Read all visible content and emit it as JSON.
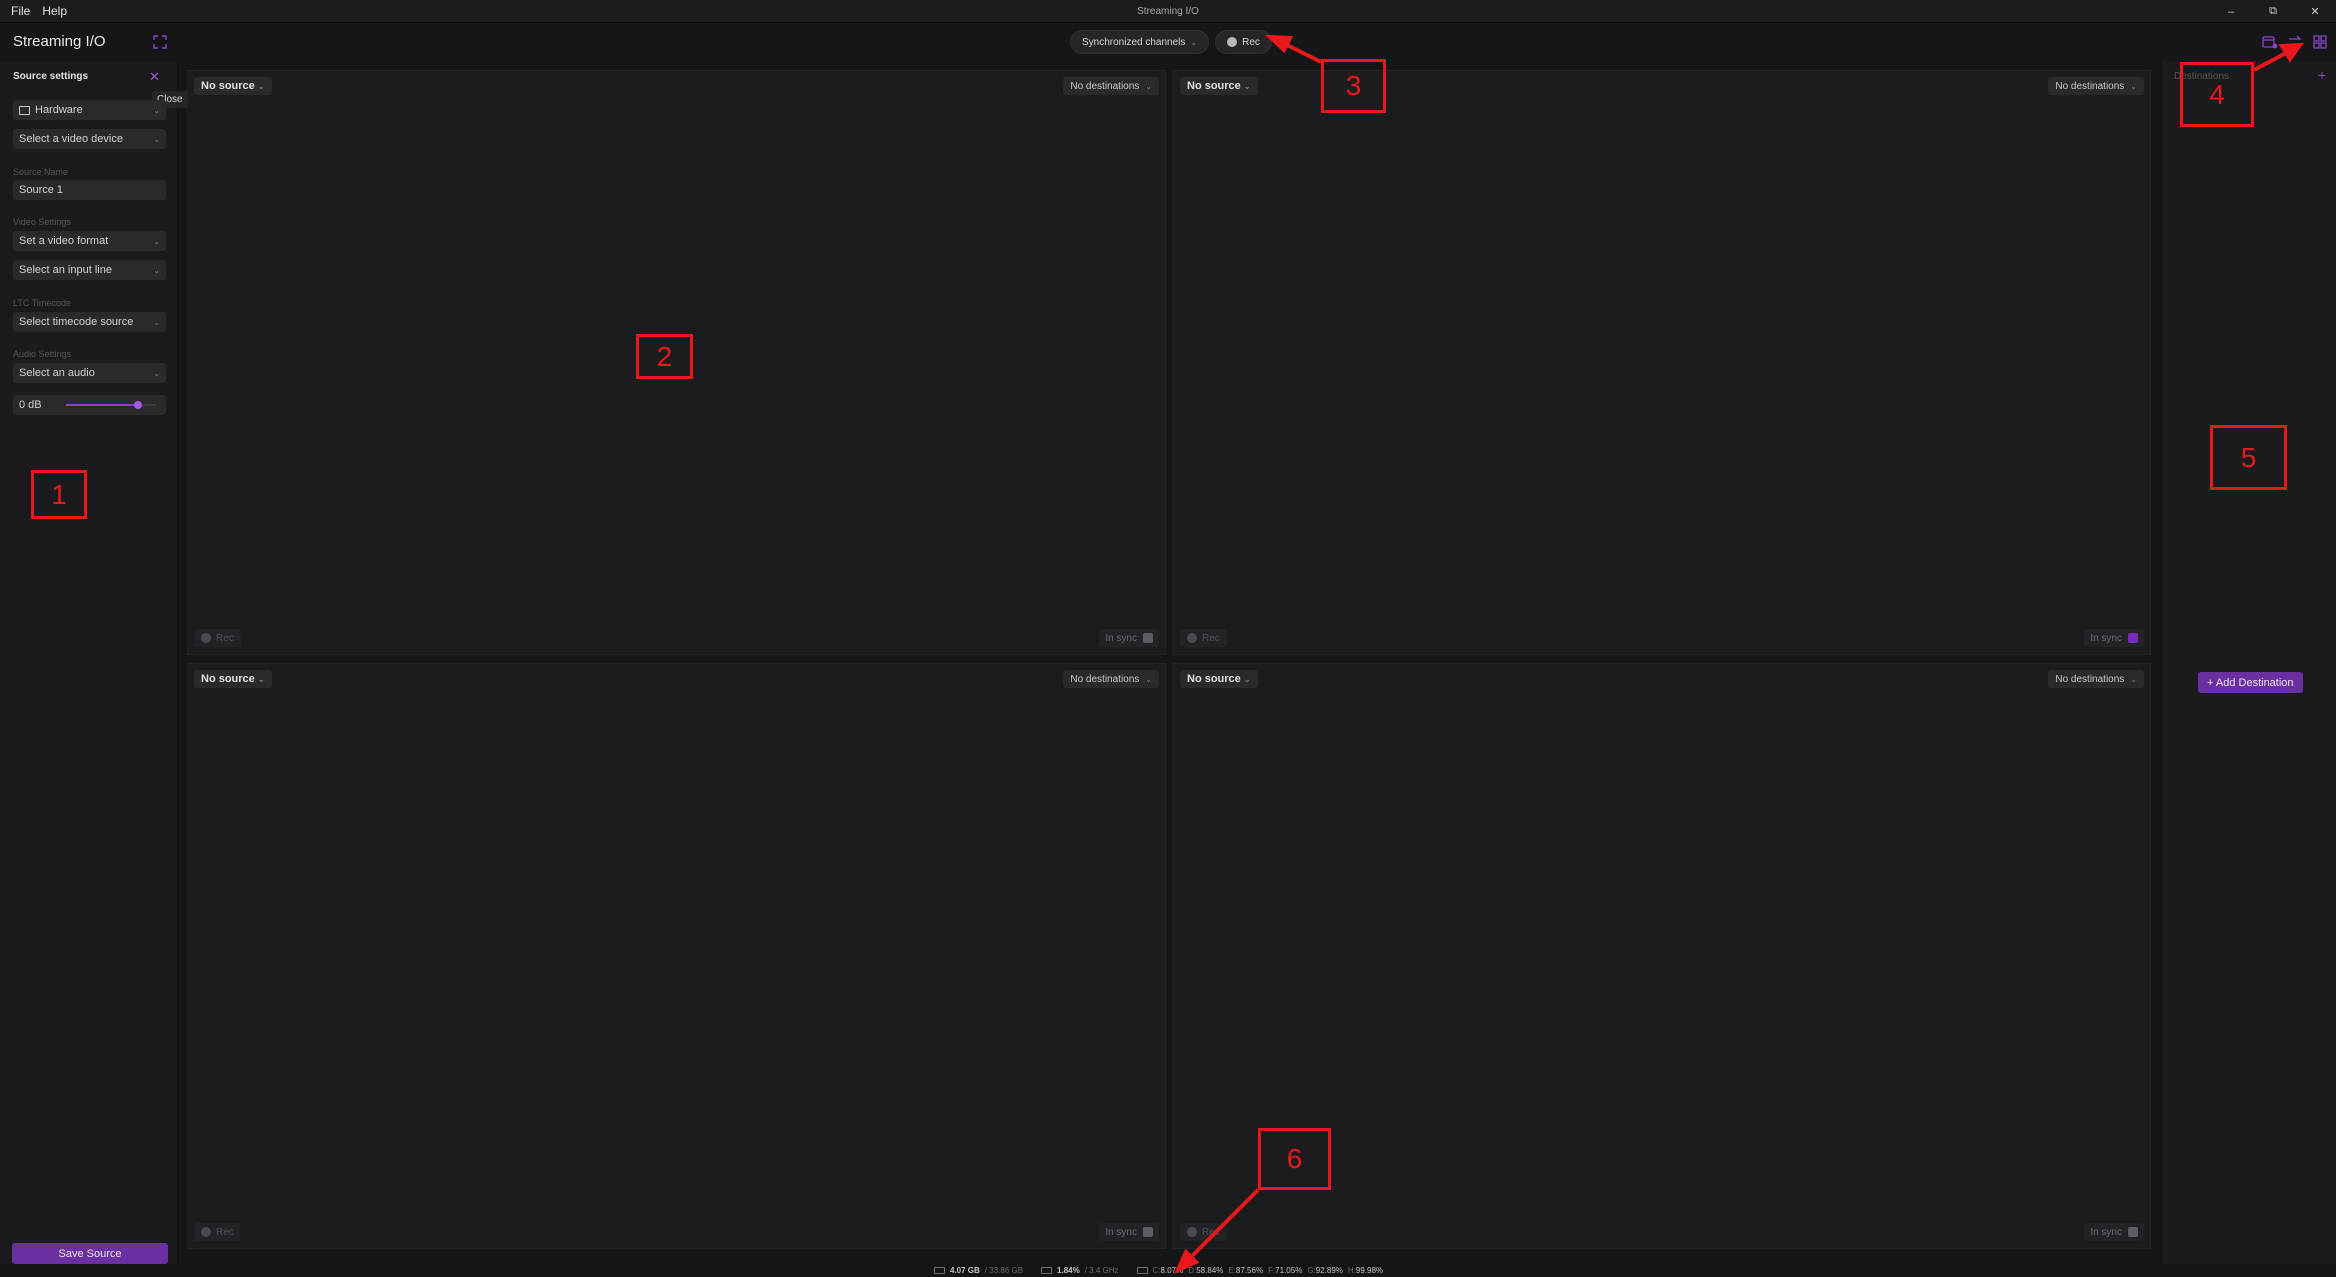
{
  "titlebar": {
    "menu": [
      "File",
      "Help"
    ],
    "window_title": "Streaming I/O"
  },
  "header": {
    "app_title": "Streaming I/O",
    "sync_label": "Synchronized channels",
    "rec_label": "Rec"
  },
  "left_panel": {
    "title": "Source settings",
    "close_tooltip": "Close",
    "source_type": "Hardware",
    "video_device": "Select a video device",
    "source_name_label": "Source Name",
    "source_name_value": "Source 1",
    "video_settings_label": "Video Settings",
    "video_format": "Set a video format",
    "input_line": "Select an input line",
    "ltc_label": "LTC Timecode",
    "timecode_source": "Select timecode source",
    "audio_label": "Audio Settings",
    "audio_select": "Select an audio",
    "gain_value": "0 dB",
    "gain_level": 0.8,
    "save_label": "Save Source"
  },
  "channels": [
    {
      "source": "No source",
      "destinations": "No destinations",
      "rec": "Rec",
      "sync": "In sync",
      "sync_on": false
    },
    {
      "source": "No source",
      "destinations": "No destinations",
      "rec": "Rec",
      "sync": "In sync",
      "sync_on": true
    },
    {
      "source": "No source",
      "destinations": "No destinations",
      "rec": "Rec",
      "sync": "In sync",
      "sync_on": false
    },
    {
      "source": "No source",
      "destinations": "No destinations",
      "rec": "Rec",
      "sync": "In sync",
      "sync_on": false
    }
  ],
  "right_panel": {
    "title": "Destinations",
    "add_label": "+ Add Destination"
  },
  "status": {
    "mem_used": "4.07 GB",
    "mem_total": "/ 33.86 GB",
    "cpu_used": "1.84%",
    "cpu_freq": "/ 3.4 GHz",
    "drives": [
      {
        "label": "C:",
        "value": "8.07%"
      },
      {
        "label": "D:",
        "value": "58.84%"
      },
      {
        "label": "E:",
        "value": "87.56%"
      },
      {
        "label": "F:",
        "value": "71.05%"
      },
      {
        "label": "G:",
        "value": "92.89%"
      },
      {
        "label": "H:",
        "value": "99.98%"
      }
    ]
  },
  "annotations": [
    "1",
    "2",
    "3",
    "4",
    "5",
    "6"
  ],
  "colors": {
    "accent": "#6a2fa0",
    "annotation": "#e8181c",
    "background": "#161618"
  }
}
